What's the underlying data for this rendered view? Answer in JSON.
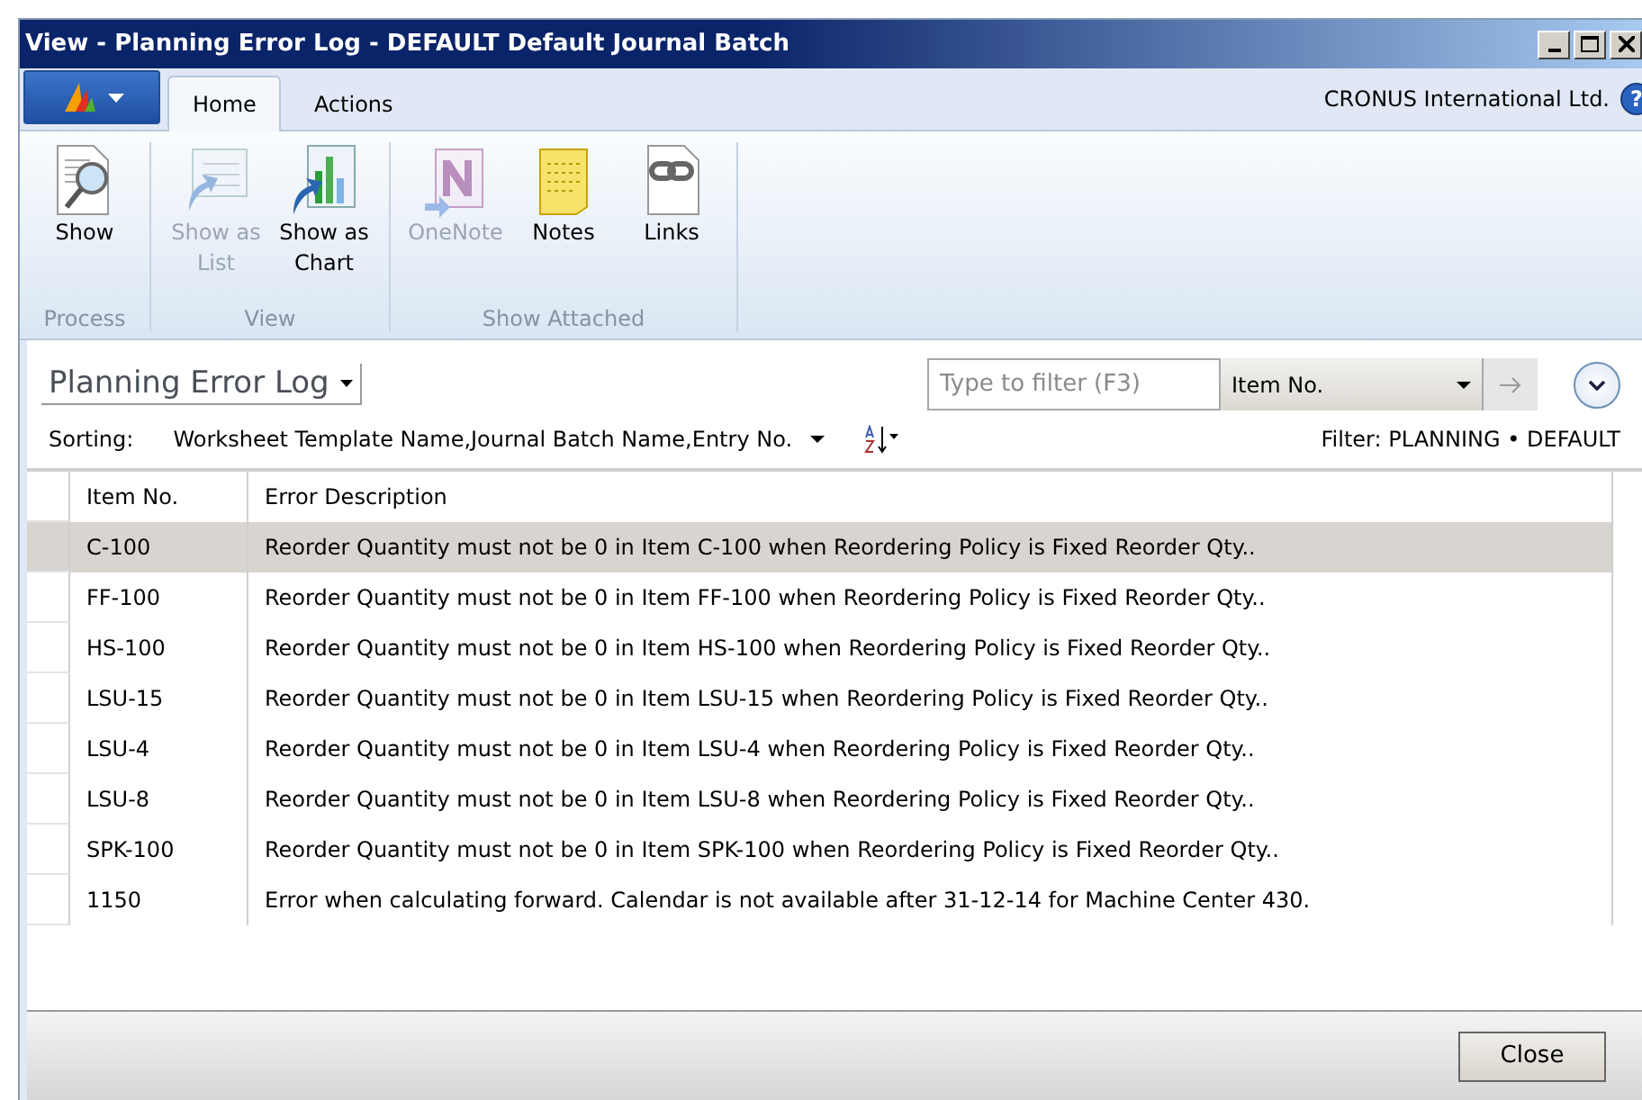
{
  "window": {
    "title": "View - Planning Error Log - DEFAULT Default Journal Batch"
  },
  "tabs": [
    {
      "label": "Home",
      "selected": true
    },
    {
      "label": "Actions",
      "selected": false
    }
  ],
  "company": "CRONUS International Ltd.",
  "help": "?",
  "ribbon": [
    {
      "label": "Process",
      "buttons": [
        {
          "label": "Show",
          "kind": "show",
          "disabled": false
        }
      ]
    },
    {
      "label": "View",
      "buttons": [
        {
          "label": "Show as List",
          "kind": "list",
          "disabled": true
        },
        {
          "label": "Show as Chart",
          "kind": "chart",
          "disabled": false
        }
      ]
    },
    {
      "label": "Show Attached",
      "buttons": [
        {
          "label": "OneNote",
          "kind": "onenote",
          "disabled": true
        },
        {
          "label": "Notes",
          "kind": "notes",
          "disabled": false
        },
        {
          "label": "Links",
          "kind": "links",
          "disabled": false
        }
      ]
    }
  ],
  "page_title": "Planning Error Log",
  "filter": {
    "placeholder": "Type to filter (F3)",
    "field": "Item No."
  },
  "sorting": {
    "label": "Sorting:",
    "value": "Worksheet Template Name,Journal Batch Name,Entry No."
  },
  "filter_text": "Filter: PLANNING • DEFAULT",
  "table": {
    "columns": [
      "Item No.",
      "Error Description"
    ],
    "rows": [
      {
        "item": "C-100",
        "error": "Reorder Quantity must not be 0 in Item C-100 when Reordering Policy is Fixed Reorder Qty..",
        "selected": true
      },
      {
        "item": "FF-100",
        "error": "Reorder Quantity must not be 0 in Item FF-100 when Reordering Policy is Fixed Reorder Qty..",
        "selected": false
      },
      {
        "item": "HS-100",
        "error": "Reorder Quantity must not be 0 in Item HS-100 when Reordering Policy is Fixed Reorder Qty..",
        "selected": false
      },
      {
        "item": "LSU-15",
        "error": "Reorder Quantity must not be 0 in Item LSU-15 when Reordering Policy is Fixed Reorder Qty..",
        "selected": false
      },
      {
        "item": "LSU-4",
        "error": "Reorder Quantity must not be 0 in Item LSU-4 when Reordering Policy is Fixed Reorder Qty..",
        "selected": false
      },
      {
        "item": "LSU-8",
        "error": "Reorder Quantity must not be 0 in Item LSU-8 when Reordering Policy is Fixed Reorder Qty..",
        "selected": false
      },
      {
        "item": "SPK-100",
        "error": "Reorder Quantity must not be 0 in Item SPK-100 when Reordering Policy is Fixed Reorder Qty..",
        "selected": false
      },
      {
        "item": "1150",
        "error": "Error when calculating forward. Calendar is not available after 31-12-14 for Machine Center 430.",
        "selected": false
      }
    ]
  },
  "buttons": [
    "Close"
  ]
}
